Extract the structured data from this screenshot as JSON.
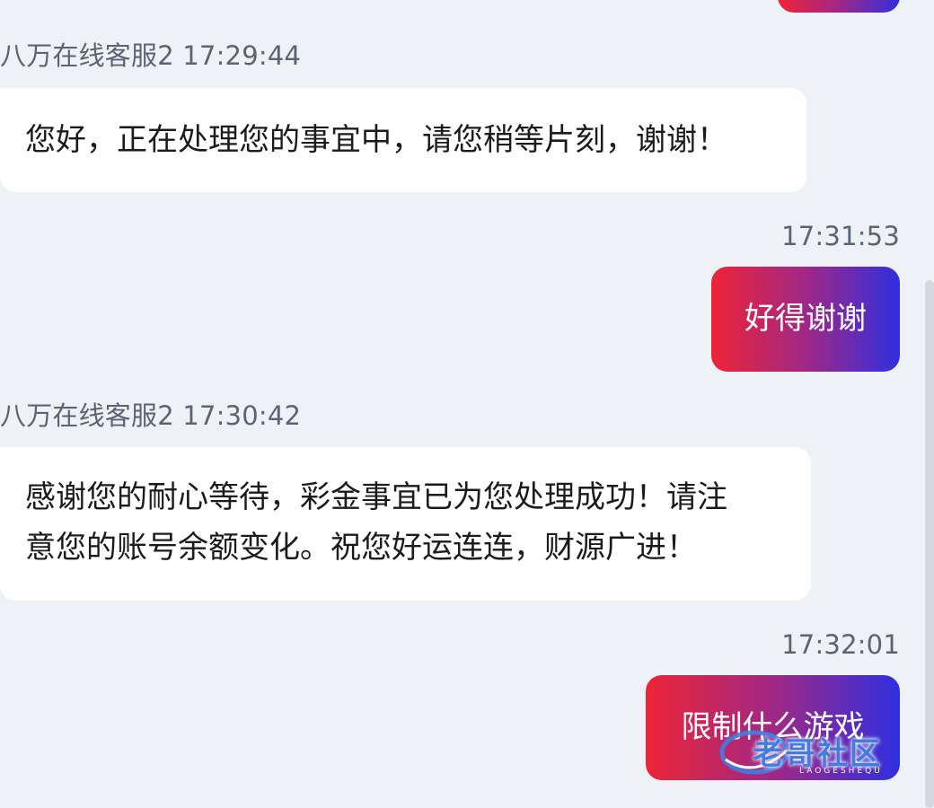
{
  "colors": {
    "background": "#eef1f6",
    "agent_bubble": "#ffffff",
    "user_bubble_gradient": [
      "#ee2436",
      "#a02886",
      "#2f2fe0"
    ],
    "meta_text": "#5a6475",
    "watermark": "#3f7ee0"
  },
  "messages": [
    {
      "sender": "user",
      "time": "",
      "text": "",
      "partial": true
    },
    {
      "sender": "agent",
      "meta": "八万在线客服2 17:29:44",
      "lines": [
        "您好，正在处理您的事宜中，请您稍等片刻，谢谢！"
      ]
    },
    {
      "sender": "user",
      "time": "17:31:53",
      "text": "好得谢谢"
    },
    {
      "sender": "agent",
      "meta": "八万在线客服2 17:30:42",
      "lines": [
        "感谢您的耐心等待，彩金事宜已为您处理成功！请注",
        "意您的账号余额变化。祝您好运连连，财源广进！"
      ]
    },
    {
      "sender": "user",
      "time": "17:32:01",
      "text": "限制什么游戏"
    }
  ],
  "watermark": {
    "title": "老哥社区",
    "subtitle": "LAOGESHEQU",
    "icon": "globe-swoosh-logo"
  }
}
